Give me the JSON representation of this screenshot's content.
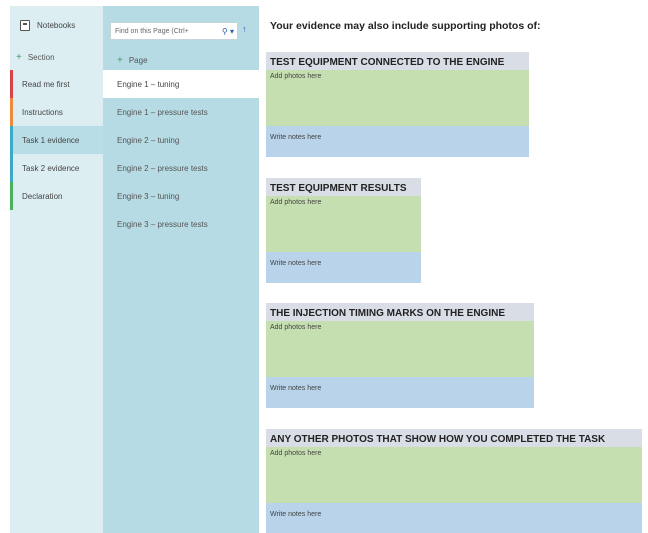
{
  "sidebar": {
    "notebooks_label": "Notebooks",
    "add_section_label": "Section",
    "sections": [
      {
        "label": "Read me first",
        "color": "#d9434a"
      },
      {
        "label": "Instructions",
        "color": "#f08a3a"
      },
      {
        "label": "Task 1 evidence",
        "color": "#3da9c7",
        "active": true
      },
      {
        "label": "Task 2 evidence",
        "color": "#3da9c7"
      },
      {
        "label": "Declaration",
        "color": "#4bb05a"
      }
    ]
  },
  "pages": {
    "search_placeholder": "Find on this Page (Ctrl+",
    "add_page_label": "Page",
    "items": [
      {
        "label": "Engine 1 – tuning",
        "active": true
      },
      {
        "label": "Engine 1 – pressure tests"
      },
      {
        "label": "Engine 2 – tuning"
      },
      {
        "label": "Engine 2 – pressure tests"
      },
      {
        "label": "Engine 3 – tuning"
      },
      {
        "label": "Engine 3 – pressure tests"
      }
    ]
  },
  "content": {
    "heading": "Your evidence may also include supporting photos of:",
    "tables": [
      {
        "title": "TEST EQUIPMENT CONNECTED TO THE ENGINE",
        "photos": "Add photos here",
        "notes": "Write notes here"
      },
      {
        "title": "TEST EQUIPMENT RESULTS",
        "photos": "Add photos here",
        "notes": "Write notes here"
      },
      {
        "title": "THE INJECTION TIMING MARKS ON THE ENGINE",
        "photos": "Add photos here",
        "notes": "Write notes here"
      },
      {
        "title": "ANY OTHER PHOTOS THAT SHOW HOW YOU COMPLETED THE TASK",
        "photos": "Add photos here",
        "notes": "Write notes here"
      }
    ]
  }
}
